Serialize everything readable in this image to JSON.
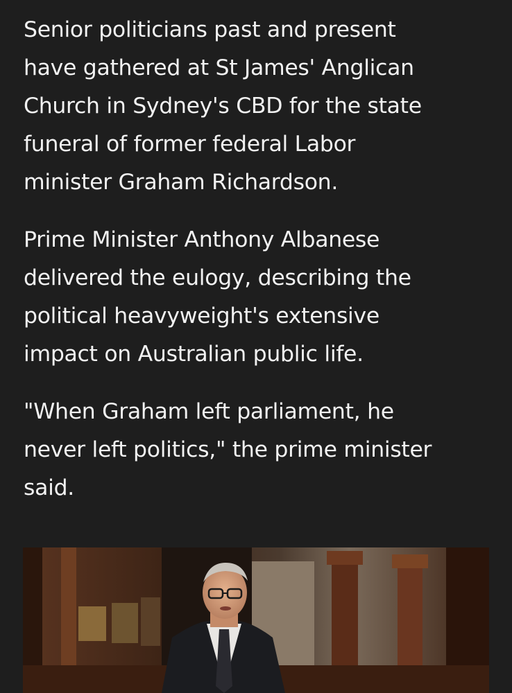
{
  "article": {
    "paragraphs": [
      "Senior politicians past and present\nhave gathered at St James' Anglican\nChurch in Sydney's CBD for the state\nfuneral of former federal Labor\nminister Graham Richardson.",
      "Prime Minister Anthony Albanese\ndelivered the eulogy, describing the\npolitical heavyweight's extensive\nimpact on Australian public life.",
      "\"When Graham left parliament, he\nnever left politics,\" the prime minister\nsaid."
    ]
  },
  "colors": {
    "background": "#1e1e1e",
    "text": "#f2f2f2"
  }
}
